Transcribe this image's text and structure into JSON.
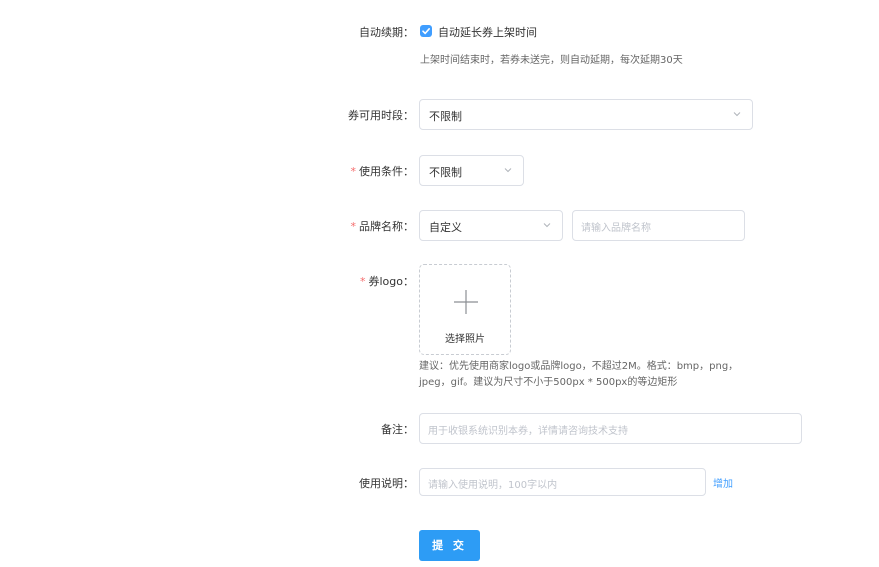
{
  "auto_renew": {
    "label": "自动续期：",
    "checkbox_label": "自动延长券上架时间",
    "checked": true,
    "hint": "上架时间结束时，若券未送完，则自动延期，每次延期30天"
  },
  "available_period": {
    "label": "券可用时段：",
    "value": "不限制"
  },
  "usage_condition": {
    "label": "使用条件：",
    "required_mark": "*",
    "value": "不限制"
  },
  "brand_name": {
    "label": "品牌名称：",
    "required_mark": "*",
    "type_value": "自定义",
    "input_placeholder": "请输入品牌名称"
  },
  "coupon_logo": {
    "label": "券logo：",
    "required_mark": "*",
    "upload_text": "选择照片",
    "hint_line1": "建议：优先使用商家logo或品牌logo，不超过2M。格式：bmp，png，",
    "hint_line2": "jpeg，gif。建议为尺寸不小于500px * 500px的等边矩形"
  },
  "remarks": {
    "label": "备注：",
    "placeholder": "用于收银系统识别本券，详情请咨询技术支持"
  },
  "instructions": {
    "label": "使用说明：",
    "placeholder": "请输入使用说明，100字以内",
    "add_link": "增加"
  },
  "submit": {
    "label": "提 交"
  },
  "colors": {
    "primary": "#409eff",
    "submit_bg": "#2d9cf5",
    "required": "#f56c6c",
    "border": "#dcdfe6",
    "placeholder": "#c0c4cc"
  }
}
